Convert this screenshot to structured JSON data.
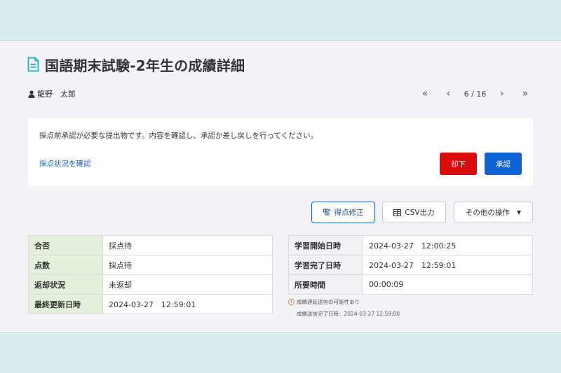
{
  "page": {
    "title": "国語期末試験-2年生の成績詳細",
    "user_name": "龍野　太郎"
  },
  "pager": {
    "first_icon": "«",
    "prev_icon": "‹",
    "count": "6 / 16",
    "next_icon": "›",
    "last_icon": "»"
  },
  "notice": {
    "message": "採点前承認が必要な提出物です。内容を確認し、承認か差し戻しを行ってください。",
    "link": "採点状況を確認",
    "reject_label": "却下",
    "approve_label": "承認"
  },
  "toolbar": {
    "score_edit_label": "得点修正",
    "csv_label": "CSV出力",
    "more_label": "その他の操作"
  },
  "left_table": [
    {
      "label": "合否",
      "value": "採点待"
    },
    {
      "label": "点数",
      "value": "採点待"
    },
    {
      "label": "返却状況",
      "value": "未返却"
    },
    {
      "label": "最終更新日時",
      "value": "2024-03-27　12:59:01"
    }
  ],
  "right_table": [
    {
      "label": "学習開始日時",
      "value": "2024-03-27　12:00:25"
    },
    {
      "label": "学習完了日時",
      "value": "2024-03-27　12:59:01"
    },
    {
      "label": "所要時間",
      "value": "00:00:09"
    }
  ],
  "notes": {
    "warning": "成績遅延送信の可能性あり",
    "sent": "成績送信完了日時：2024-03-27 12:59:00"
  },
  "colors": {
    "reject": "#d90b0b",
    "approve": "#0d62d4",
    "label_bg_green": "#e3f0dc",
    "link": "#1a5fb4"
  }
}
